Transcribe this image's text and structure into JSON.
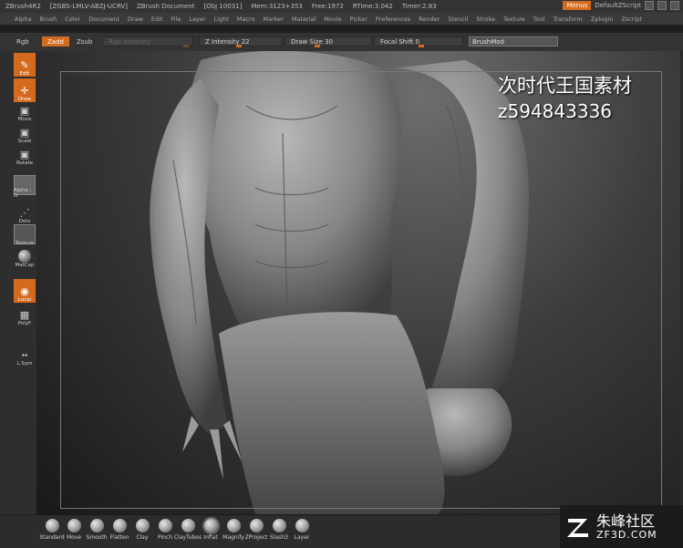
{
  "title_bar": {
    "app": "ZBrush4R2",
    "build": "[ZGBS-LMLV-ABZJ-UCRV]",
    "document": "ZBrush Document",
    "obj": "[Obj 10031]",
    "mem": "Mem:3123+353",
    "free": "Free:1972",
    "rtime": "RTime:3.042",
    "timer": "Timer:2.83",
    "menus_label": "Menus",
    "script_label": "DefaultZScript"
  },
  "menu_bar": [
    "Alpha",
    "Brush",
    "Color",
    "Document",
    "Draw",
    "Edit",
    "File",
    "Layer",
    "Light",
    "Macro",
    "Marker",
    "Material",
    "Movie",
    "Picker",
    "Preferences",
    "Render",
    "Stencil",
    "Stroke",
    "Texture",
    "Tool",
    "Transform",
    "Zplugin",
    "Zscript"
  ],
  "shelf": {
    "rgb": "Rgb",
    "zadd": "Zadd",
    "zsub": "Zsub",
    "rgb_intensity": "Rgb Intensity",
    "z_intensity": "Z Intensity 22",
    "draw_size": "Draw Size 30",
    "focal_shift": "Focal Shift 0",
    "brushmod": "BrushMod"
  },
  "left_tools": {
    "edit": "Edit",
    "draw": "Draw",
    "move": "Move",
    "scale": "Scale",
    "rotate": "Rotate",
    "alpha": "Alpha : O",
    "dots": "Dots",
    "texture": "Texture",
    "matcap": "MatCap",
    "local": "Local",
    "polyf": "PolyF",
    "lsym": "L.Sym"
  },
  "watermark": {
    "line1": "次时代王国素材",
    "line2": "z594843336"
  },
  "brushes": [
    "Standard",
    "Move",
    "Smooth",
    "Flatten",
    "Clay",
    "Pinch",
    "ClayTubes",
    "Inflat",
    "Magnify",
    "ZProject",
    "Slash3",
    "Layer"
  ],
  "logo": {
    "cn": "朱峰社区",
    "en": "ZF3D.COM"
  },
  "colors": {
    "accent": "#d46a1e",
    "panel": "#333333",
    "canvas": "#3c3c3c"
  }
}
